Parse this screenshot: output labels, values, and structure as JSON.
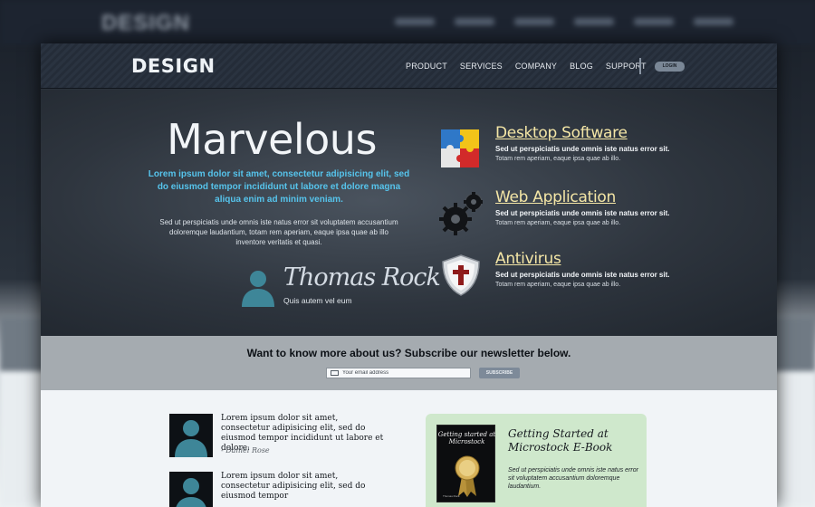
{
  "header": {
    "logo": "DESIGN",
    "nav": [
      "PRODUCT",
      "SERVICES",
      "COMPANY",
      "BLOG",
      "SUPPORT"
    ],
    "login_label": "LOGIN"
  },
  "hero": {
    "title": "Marvelous",
    "lead": "Lorem ipsum dolor sit amet, consectetur adipisicing elit, sed do eiusmod tempor incididunt ut labore et dolore magna aliqua  enim ad minim veniam.",
    "body": "Sed ut perspiciatis unde omnis iste natus error sit voluptatem accusantium doloremque laudantium, totam rem aperiam, eaque ipsa quae ab illo inventore veritatis et quasi.",
    "signature": "Thomas Rock",
    "signature_caption": "Quis autem vel eum"
  },
  "features": [
    {
      "title": "Desktop Software",
      "line1": "Sed ut perspiciatis unde omnis iste natus error sit.",
      "line2": "Totam rem aperiam, eaque ipsa quae ab illo.",
      "icon": "puzzle-icon"
    },
    {
      "title": "Web Application",
      "line1": "Sed ut perspiciatis unde omnis iste natus error sit.",
      "line2": "Totam rem aperiam, eaque ipsa quae ab illo.",
      "icon": "gears-icon"
    },
    {
      "title": "Antivirus",
      "line1": "Sed ut perspiciatis unde omnis iste natus error sit.",
      "line2": "Totam rem aperiam, eaque ipsa quae ab illo.",
      "icon": "shield-icon"
    }
  ],
  "newsletter": {
    "heading": "Want to know more about us? Subscribe our newsletter below.",
    "placeholder": "Your email address",
    "button": "SUBSCRIBE"
  },
  "testimonials": [
    {
      "text": "Lorem ipsum dolor sit amet, consectetur adipisicing elit, sed do eiusmod tempor incididunt ut labore et dolore.",
      "author": "- Daniel Rose"
    },
    {
      "text": "Lorem ipsum dolor sit amet, consectetur adipisicing elit, sed do eiusmod tempor"
    }
  ],
  "ebook": {
    "cover_title": "Getting started at Microstock",
    "cover_author": "Thomas Rock",
    "title": "Getting Started at Microstock E-Book",
    "body": "Sed ut perspiciatis unde omnis iste natus error sit voluptatem accusantium doloremque laudantium."
  },
  "colors": {
    "accent_blue": "#56c4ec",
    "feature_title": "#f4e6a6",
    "ebook_bg": "#cfe8cc"
  }
}
